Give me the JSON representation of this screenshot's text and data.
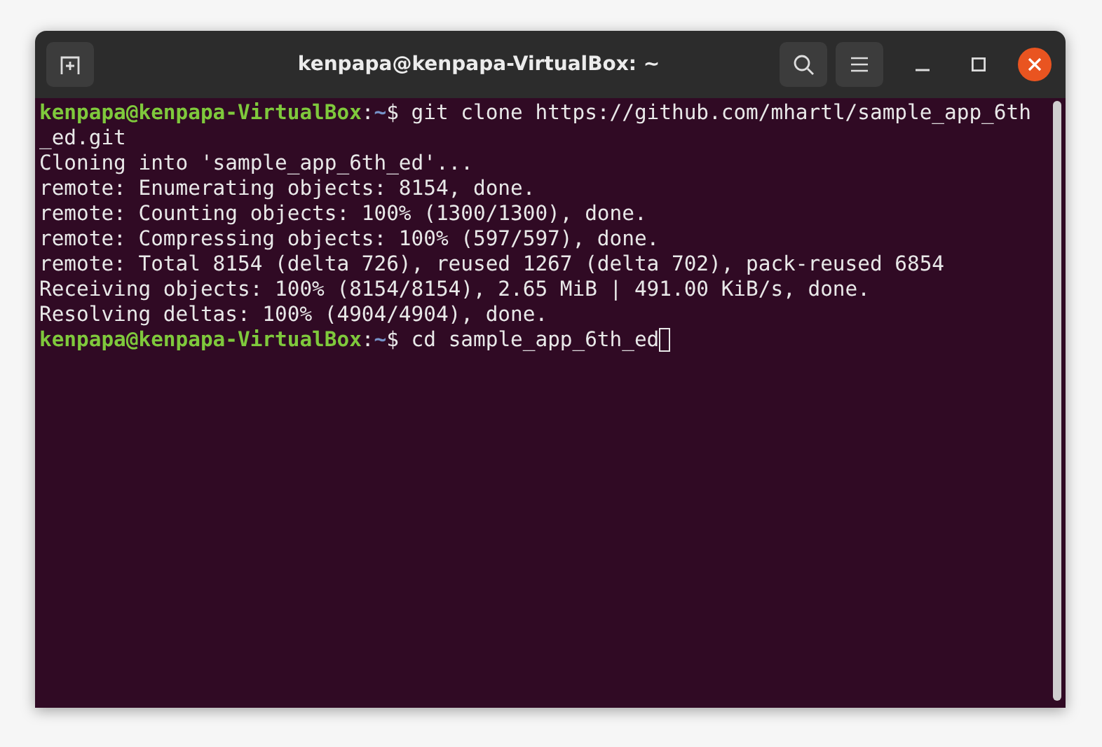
{
  "window": {
    "title": "kenpapa@kenpapa-VirtualBox: ~"
  },
  "terminal": {
    "lines": [
      {
        "kind": "prompt",
        "user_host": "kenpapa@kenpapa-VirtualBox",
        "separator": ":",
        "path": "~",
        "symbol": "$",
        "command": "git clone https://github.com/mhartl/sample_app_6th_ed.git",
        "cursor": false
      },
      {
        "kind": "output",
        "text": "Cloning into 'sample_app_6th_ed'..."
      },
      {
        "kind": "output",
        "text": "remote: Enumerating objects: 8154, done."
      },
      {
        "kind": "output",
        "text": "remote: Counting objects: 100% (1300/1300), done."
      },
      {
        "kind": "output",
        "text": "remote: Compressing objects: 100% (597/597), done."
      },
      {
        "kind": "output",
        "text": "remote: Total 8154 (delta 726), reused 1267 (delta 702), pack-reused 6854"
      },
      {
        "kind": "output",
        "text": "Receiving objects: 100% (8154/8154), 2.65 MiB | 491.00 KiB/s, done."
      },
      {
        "kind": "output",
        "text": "Resolving deltas: 100% (4904/4904), done."
      },
      {
        "kind": "prompt",
        "user_host": "kenpapa@kenpapa-VirtualBox",
        "separator": ":",
        "path": "~",
        "symbol": "$",
        "command": "cd sample_app_6th_ed",
        "cursor": true
      }
    ]
  }
}
